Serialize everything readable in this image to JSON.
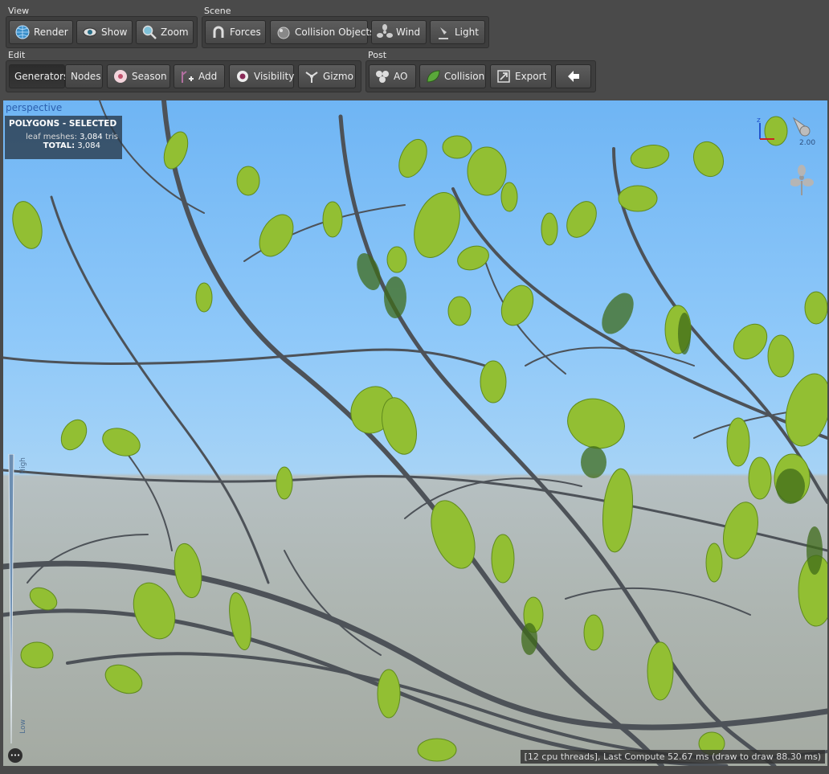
{
  "toolbar": {
    "view": {
      "label": "View",
      "render": "Render",
      "show": "Show",
      "zoom": "Zoom"
    },
    "scene": {
      "label": "Scene",
      "forces": "Forces",
      "collision_objects": "Collision Objects",
      "wind": "Wind",
      "light": "Light"
    },
    "edit": {
      "label": "Edit",
      "generators": "Generators",
      "nodes": "Nodes",
      "season": "Season",
      "add": "Add",
      "visibility": "Visibility",
      "gizmo": "Gizmo"
    },
    "post": {
      "label": "Post",
      "ao": "AO",
      "collision": "Collision",
      "export": "Export"
    }
  },
  "viewport": {
    "mode": "perspective",
    "stats": {
      "title": "POLYGONS - SELECTED",
      "leaf_label": "leaf meshes:",
      "leaf_value": "3,084",
      "leaf_unit": "tris",
      "total_label": "TOTAL:",
      "total_value": "3,084"
    },
    "light_intensity": "2.00",
    "axis_label": "z",
    "gauge": {
      "high": "High",
      "low": "Low"
    },
    "more_glyph": "•••",
    "status": "[12 cpu threads], Last Compute 52.67 ms (draw to draw 88.30 ms)"
  },
  "colors": {
    "sky": "#8ec8f9",
    "ground": "#aeb6b2",
    "leaf": "#8dbb2e",
    "branch": "#4a4f55",
    "toolbar": "#4a4a4a"
  }
}
